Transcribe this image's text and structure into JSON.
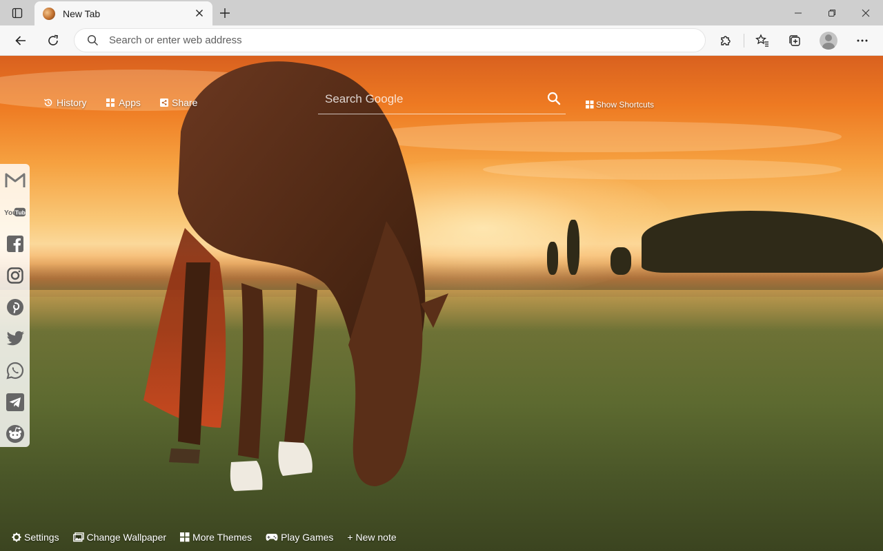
{
  "browser": {
    "tab": {
      "title": "New Tab",
      "favicon": "horse-favicon"
    },
    "address_bar": {
      "placeholder": "Search or enter web address",
      "value": ""
    },
    "icons": {
      "sidebar": "tab-actions-icon",
      "close_tab": "close-icon",
      "new_tab": "plus-icon",
      "back": "arrow-left-icon",
      "refresh": "refresh-icon",
      "extensions": "puzzle-icon",
      "favorites": "star-list-icon",
      "collections": "collections-icon",
      "profile": "avatar",
      "menu": "more-icon"
    },
    "window_controls": [
      "minimize",
      "restore",
      "close"
    ]
  },
  "newtab": {
    "wallpaper": "horse grazing in a meadow at sunset",
    "top_links": [
      {
        "label": "History",
        "icon": "history-icon"
      },
      {
        "label": "Apps",
        "icon": "apps-grid-icon"
      },
      {
        "label": "Share",
        "icon": "share-icon"
      }
    ],
    "search": {
      "placeholder": "Search Google"
    },
    "shortcuts": {
      "label": "Show Shortcuts",
      "icon": "grid-icon"
    },
    "social_links": [
      "gmail",
      "youtube",
      "facebook",
      "instagram",
      "pinterest",
      "twitter",
      "whatsapp",
      "telegram",
      "reddit"
    ],
    "youtube_text": "YouTube",
    "bottom_links": [
      {
        "label": "Settings",
        "icon": "gear-icon"
      },
      {
        "label": "Change Wallpaper",
        "icon": "image-icon"
      },
      {
        "label": "More Themes",
        "icon": "grid-icon"
      },
      {
        "label": "Play Games",
        "icon": "gamepad-icon"
      },
      {
        "label": "+ New note",
        "icon": ""
      }
    ]
  },
  "colors": {
    "titlebar": "#cfcfcf",
    "toolbar": "#f7f7f7",
    "sky_top": "#d9611f",
    "sky_glow": "#fbd89a",
    "grass": "#5d6a30"
  }
}
